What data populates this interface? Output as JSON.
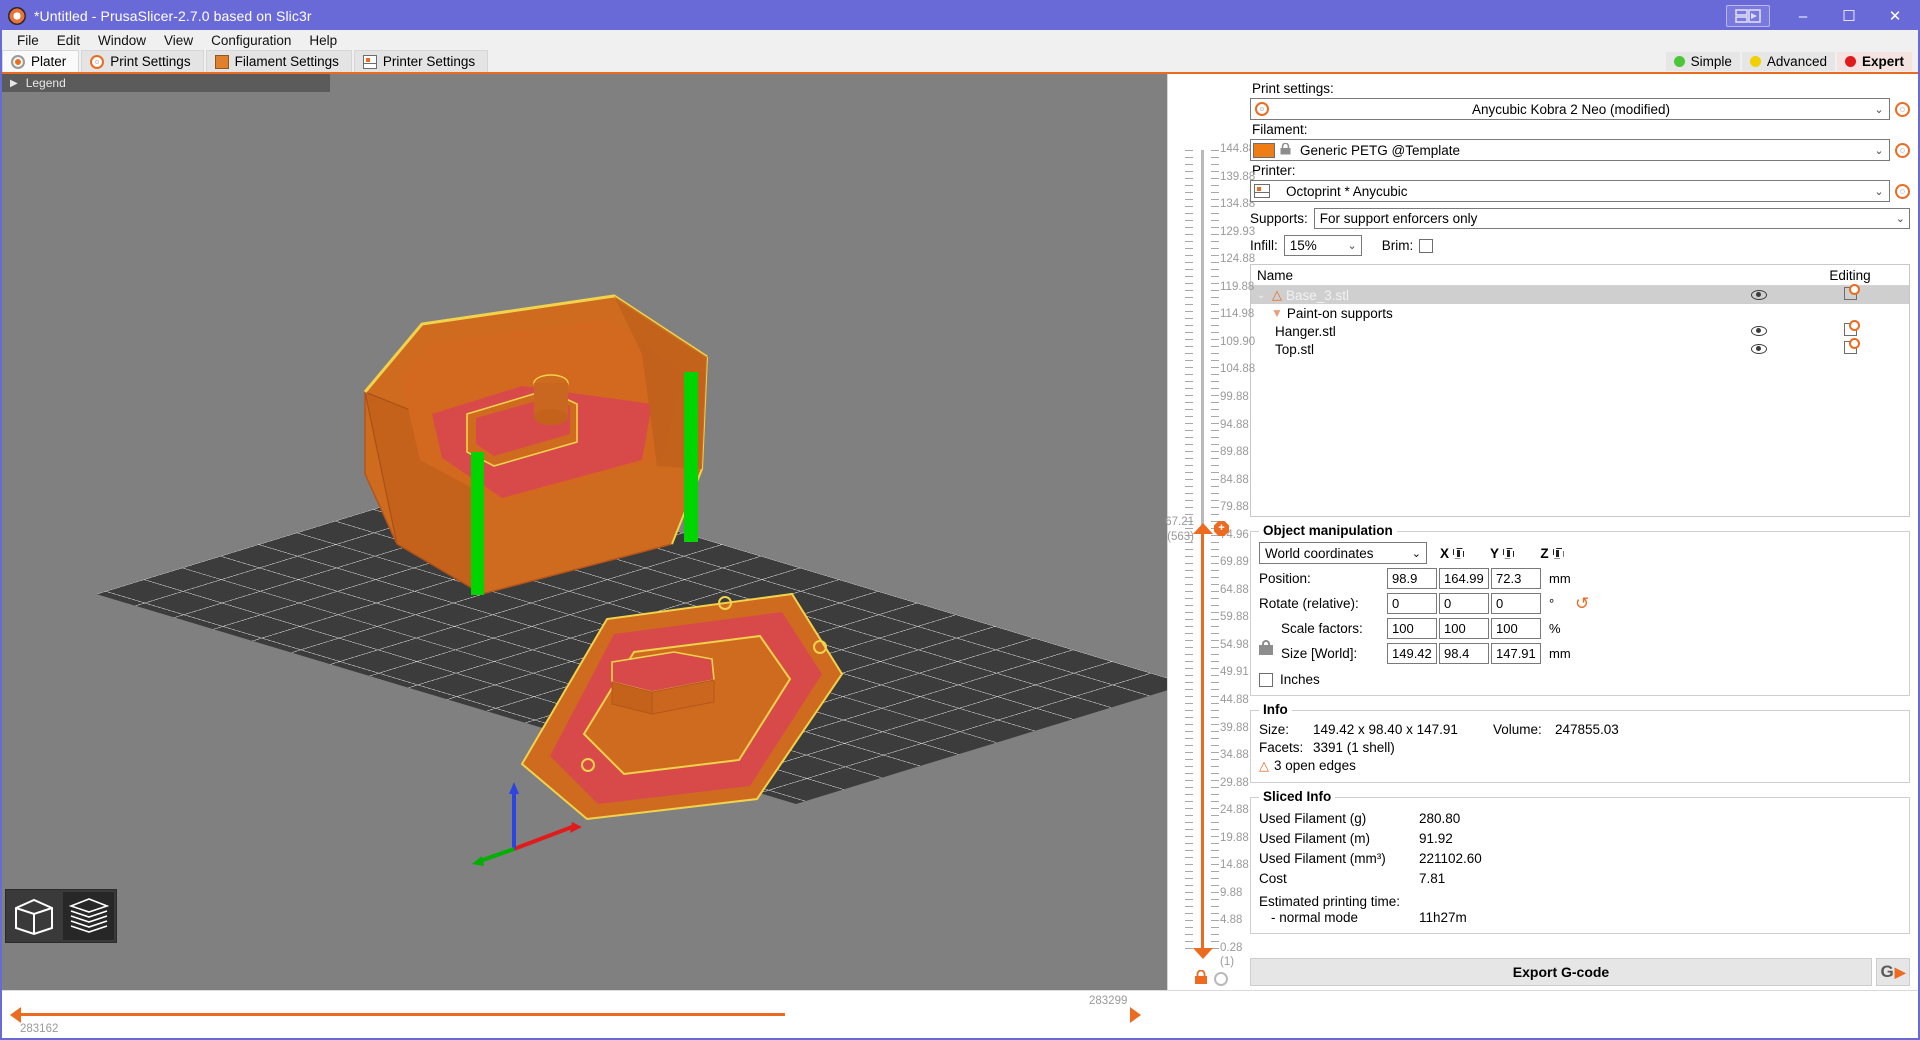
{
  "window": {
    "title": "*Untitled - PrusaSlicer-2.7.0 based on Slic3r",
    "app_icon": "prusaslicer-logo-icon",
    "layout_button": "layout-toggle-icon",
    "minimize": "–",
    "maximize": "☐",
    "close": "✕",
    "accent": "#6a69d8"
  },
  "menubar": {
    "items": [
      {
        "label": "File"
      },
      {
        "label": "Edit"
      },
      {
        "label": "Window"
      },
      {
        "label": "View"
      },
      {
        "label": "Configuration"
      },
      {
        "label": "Help"
      }
    ]
  },
  "tabs": [
    {
      "label": "Plater",
      "icon": "plater-icon",
      "active": true
    },
    {
      "label": "Print Settings",
      "icon": "print-settings-icon",
      "active": false
    },
    {
      "label": "Filament Settings",
      "icon": "filament-settings-icon",
      "active": false
    },
    {
      "label": "Printer Settings",
      "icon": "printer-settings-icon",
      "active": false
    }
  ],
  "modes": {
    "simple": {
      "label": "Simple",
      "color": "#4bc637"
    },
    "advanced": {
      "label": "Advanced",
      "color": "#f0d000"
    },
    "expert": {
      "label": "Expert",
      "color": "#e01b1b",
      "selected": true
    }
  },
  "viewport": {
    "legend_label": "Legend",
    "legend_arrow": "▶",
    "bed_color": "#3c3c3c",
    "background_color": "#808080",
    "model_colors": {
      "object": "#d2691e",
      "support": "#00d000",
      "infill": "#d84a4a",
      "perimeter_highlight": "#f0d24b"
    }
  },
  "view_toggle": {
    "solid": "3d-editor-view-icon",
    "layers": "preview-layers-icon",
    "active": "layers"
  },
  "layer_slider": {
    "ticks": [
      "144.88",
      "139.88",
      "134.88",
      "129.93",
      "124.88",
      "119.88",
      "114.98",
      "109.90",
      "104.88",
      "99.88",
      "94.88",
      "89.88",
      "84.88",
      "79.88",
      "74.96",
      "69.89",
      "64.88",
      "59.88",
      "54.98",
      "49.91",
      "44.88",
      "39.88",
      "34.88",
      "29.88",
      "24.88",
      "19.88",
      "14.88",
      "9.88",
      "4.88",
      "0.28"
    ],
    "current_value": "67.21",
    "current_layer": "(563)",
    "bottom_layer": "(1)",
    "marker_glyph": "+",
    "lock_glyph": "⚿"
  },
  "horizontal_slider": {
    "left_value": "283162",
    "right_value": "283299"
  },
  "sidebar": {
    "print_settings": {
      "label": "Print settings:",
      "value": "Anycubic Kobra 2 Neo (modified)",
      "icon": "print-settings-icon",
      "edit_icon": "gear-icon",
      "caret": "⌄"
    },
    "filament": {
      "label": "Filament:",
      "value": "Generic PETG @Template",
      "swatch_color": "#ef7d16",
      "lock_icon": "lock-icon",
      "edit_icon": "gear-icon",
      "caret": "⌄"
    },
    "printer": {
      "label": "Printer:",
      "value": "Octoprint * Anycubic",
      "icon": "printer-icon",
      "edit_icon": "gear-icon",
      "caret": "⌄"
    },
    "supports": {
      "label": "Supports:",
      "value": "For support enforcers only",
      "caret": "⌄"
    },
    "infill": {
      "label": "Infill:",
      "value": "15%",
      "caret": "⌄"
    },
    "brim": {
      "label": "Brim:",
      "checked": false
    },
    "object_list": {
      "columns": {
        "name": "Name",
        "visibility": "",
        "editing": "Editing"
      },
      "rows": [
        {
          "name": "Base_3.stl",
          "selected": true,
          "has_warning": true,
          "expanded": true,
          "chevron": "⌄",
          "eye": "eye-icon",
          "edit": "edit-object-icon",
          "indent": 0
        },
        {
          "name": "Paint-on supports",
          "selected": false,
          "has_warning": false,
          "is_child": true,
          "icon": "paint-on-supports-icon",
          "indent": 1
        },
        {
          "name": "Hanger.stl",
          "selected": false,
          "has_warning": false,
          "eye": "eye-icon",
          "edit": "edit-object-icon",
          "indent": 0
        },
        {
          "name": "Top.stl",
          "selected": false,
          "has_warning": false,
          "eye": "eye-icon",
          "edit": "edit-object-icon",
          "indent": 0
        }
      ]
    },
    "object_manipulation": {
      "title": "Object manipulation",
      "coordinate_space": "World coordinates",
      "caret": "⌄",
      "axes": [
        "X",
        "Y",
        "Z"
      ],
      "rows": [
        {
          "label": "Position:",
          "x": "98.9",
          "y": "164.99",
          "z": "72.3",
          "unit": "mm"
        },
        {
          "label": "Rotate (relative):",
          "x": "0",
          "y": "0",
          "z": "0",
          "unit": "°"
        },
        {
          "label": "Scale factors:",
          "x": "100",
          "y": "100",
          "z": "100",
          "unit": "%"
        },
        {
          "label": "Size [World]:",
          "x": "149.42",
          "y": "98.4",
          "z": "147.91",
          "unit": "mm"
        }
      ],
      "reset_icon": "reset-rotation-icon",
      "lock_icon": "uniform-scale-lock-icon",
      "inches_label": "Inches",
      "inches_checked": false
    },
    "info": {
      "title": "Info",
      "size_label": "Size:",
      "size_value": "149.42 x 98.40 x 147.91",
      "volume_label": "Volume:",
      "volume_value": "247855.03",
      "facets_label": "Facets:",
      "facets_value": "3391 (1 shell)",
      "warning": "3 open edges",
      "warning_icon": "warning-triangle-icon"
    },
    "sliced_info": {
      "title": "Sliced Info",
      "rows": [
        {
          "label": "Used Filament (g)",
          "value": "280.80"
        },
        {
          "label": "Used Filament (m)",
          "value": "91.92"
        },
        {
          "label": "Used Filament (mm³)",
          "value": "221102.60"
        },
        {
          "label": "Cost",
          "value": "7.81"
        }
      ],
      "time_label": "Estimated printing time:",
      "time_mode_label": "- normal mode",
      "time_value": "11h27m"
    },
    "export": {
      "button_label": "Export G-code",
      "send_icon": "send-to-printer-icon",
      "send_glyph": "G"
    }
  }
}
